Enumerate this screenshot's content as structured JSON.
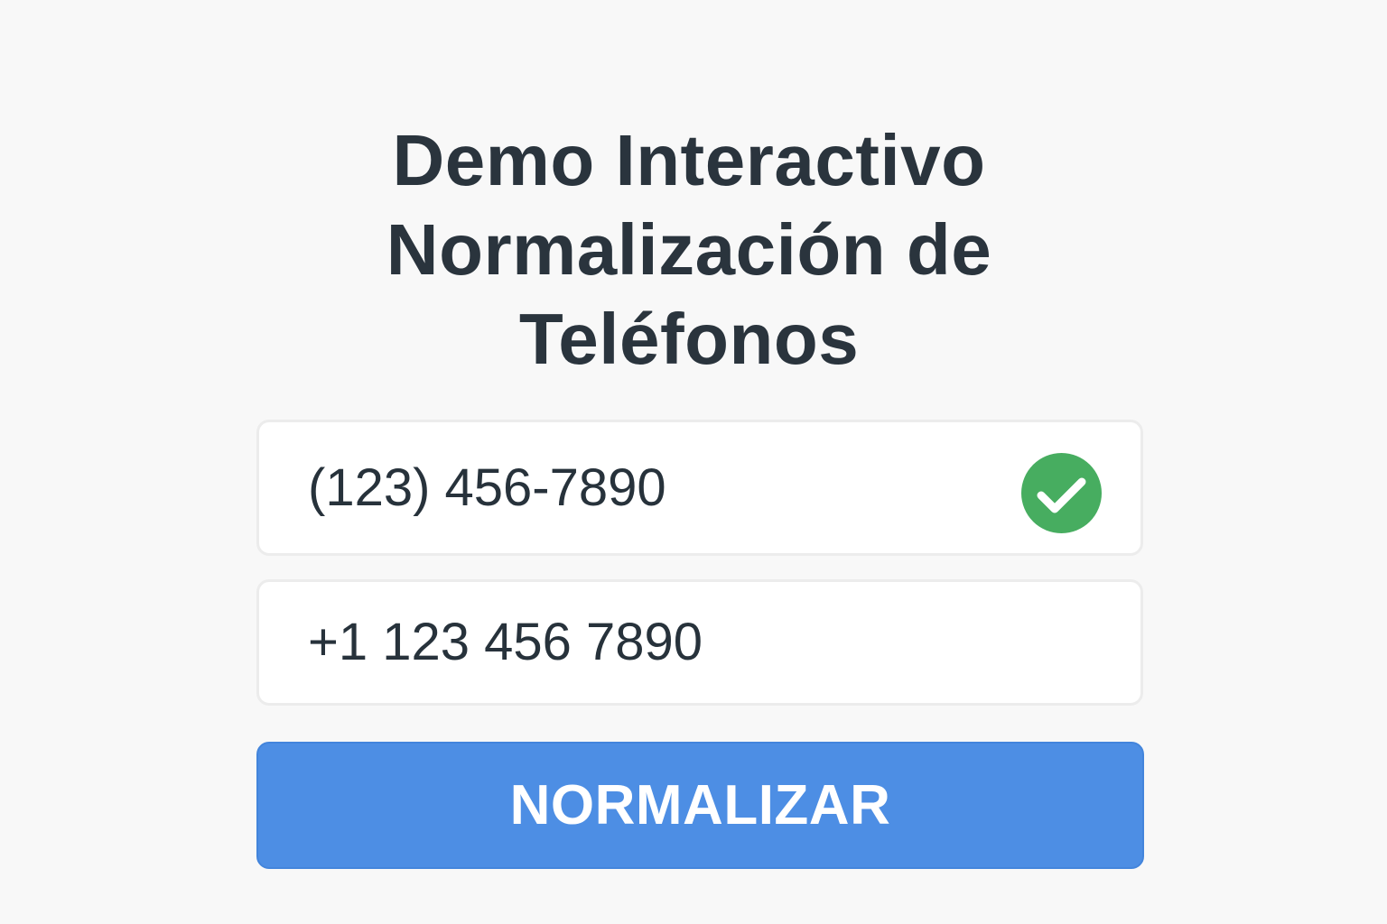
{
  "title": {
    "line1": "Demo Interactivo",
    "line2": "Normalización de",
    "line3": "Teléfonos"
  },
  "phone_input": {
    "value": "(123) 456-7890",
    "status_icon": "check-circle-icon",
    "status_color": "#47ad60"
  },
  "normalized_output": {
    "value": "+1 123 456 7890"
  },
  "normalize_button": {
    "label": "NORMALIZAR",
    "color": "#4d8ee4"
  },
  "colors": {
    "background": "#f8f8f8",
    "text": "#27323b",
    "border": "#ececec"
  }
}
